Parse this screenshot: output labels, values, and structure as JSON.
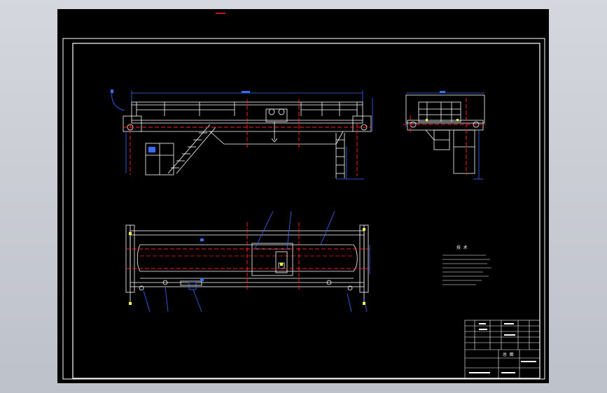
{
  "drawing": {
    "background": "#000000",
    "line_color": "#ffffff",
    "accent_red": "#ff2020",
    "accent_blue": "#3a6bff",
    "accent_green": "#24d424",
    "accent_yellow": "#ffff40",
    "notes_title": "技 术",
    "title_block_main": "总 图"
  }
}
